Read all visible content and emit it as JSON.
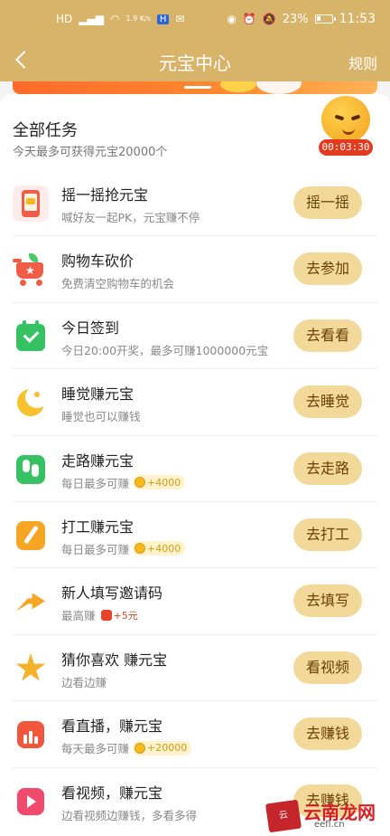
{
  "status_bar": {
    "network_speed": "1.9 K/s",
    "battery_percent": "23%",
    "time": "11:53"
  },
  "header": {
    "title": "元宝中心",
    "rules_label": "规则"
  },
  "section": {
    "title": "全部任务",
    "subtitle": "今天最多可获得元宝20000个"
  },
  "timer": "00:03:30",
  "tasks": [
    {
      "name": "摇一摇抢元宝",
      "desc": "喊好友一起PK，元宝赚不停",
      "button": "摇一摇",
      "icon": "shake-phone-icon"
    },
    {
      "name": "购物车砍价",
      "desc": "免费清空购物车的机会",
      "button": "去参加",
      "icon": "shopping-cart-icon"
    },
    {
      "name": "今日签到",
      "desc": "今日20:00开奖，最多可赚1000000元宝",
      "button": "去看看",
      "icon": "calendar-check-icon"
    },
    {
      "name": "睡觉赚元宝",
      "desc": "睡觉也可以赚钱",
      "button": "去睡觉",
      "icon": "moon-icon"
    },
    {
      "name": "走路赚元宝",
      "desc": "每日最多可赚",
      "reward": "+4000",
      "reward_icon": "coin-icon",
      "button": "去走路",
      "icon": "footprint-icon"
    },
    {
      "name": "打工赚元宝",
      "desc": "每日最多可赚",
      "reward": "+4000",
      "reward_icon": "coin-icon",
      "button": "去打工",
      "icon": "broom-icon"
    },
    {
      "name": "新人填写邀请码",
      "desc": "最高赚",
      "reward": "+5元",
      "reward_icon": "red-envelope-icon",
      "button": "去填写",
      "icon": "share-arrow-icon"
    },
    {
      "name": "猜你喜欢 赚元宝",
      "desc": "边看边赚",
      "button": "看视频",
      "icon": "star-icon"
    },
    {
      "name": "看直播，赚元宝",
      "desc": "每天最多可赚",
      "reward": "+20000",
      "reward_icon": "coin-icon",
      "button": "去赚钱",
      "icon": "live-stream-icon"
    },
    {
      "name": "看视频，赚元宝",
      "desc": "边看视频边赚钱，多看多得",
      "button": "去赚钱",
      "icon": "video-play-icon"
    }
  ],
  "watermark": {
    "text": "云南龙网",
    "sub": "eefl.cn"
  },
  "colors": {
    "header_bg": "#d8b46a",
    "button_bg": "#f2d99a",
    "button_text": "#6b3f08",
    "timer_bg": "#e23b1f"
  }
}
